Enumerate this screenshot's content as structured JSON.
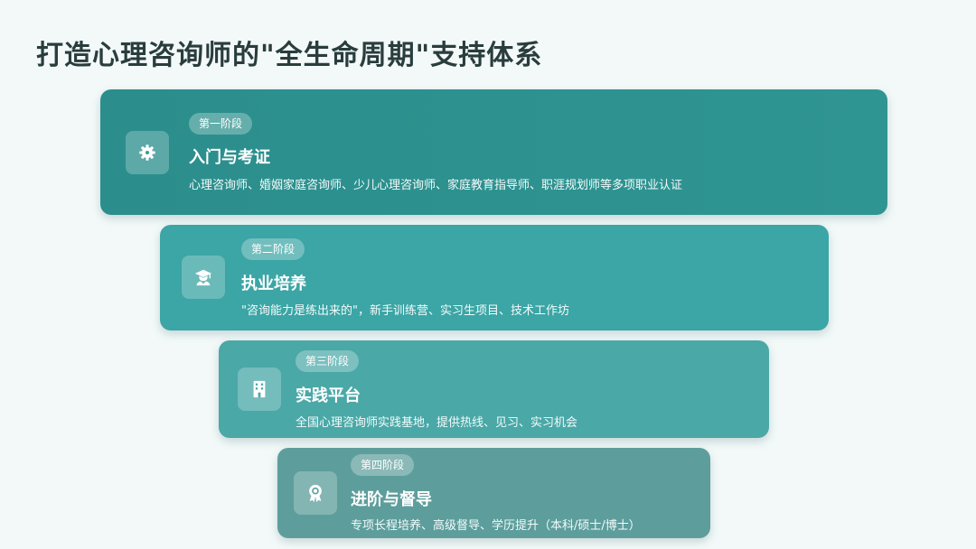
{
  "title": "打造心理咨询师的\"全生命周期\"支持体系",
  "stages": [
    {
      "badge": "第一阶段",
      "title": "入门与考证",
      "description": "心理咨询师、婚姻家庭咨询师、少儿心理咨询师、家庭教育指导师、职涯规划师等多项职业认证",
      "icon": "gear-icon"
    },
    {
      "badge": "第二阶段",
      "title": "执业培养",
      "description": "\"咨询能力是练出来的\"，新手训练营、实习生项目、技术工作坊",
      "icon": "graduate-icon"
    },
    {
      "badge": "第三阶段",
      "title": "实践平台",
      "description": "全国心理咨询师实践基地，提供热线、见习、实习机会",
      "icon": "building-icon"
    },
    {
      "badge": "第四阶段",
      "title": "进阶与督导",
      "description": "专项长程培养、高级督导、学历提升（本科/硕士/博士）",
      "icon": "award-icon"
    }
  ],
  "colors": {
    "stage1": "#2b8e8c",
    "stage2": "#3ca5a5",
    "stage3": "#4aa8a7",
    "stage4": "#5d9e9c",
    "title": "#2a3d3d",
    "background": "#f3f9f9"
  }
}
